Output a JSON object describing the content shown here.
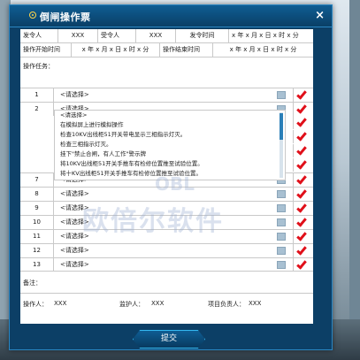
{
  "dialog": {
    "title": "倒闸操作票",
    "close": "×"
  },
  "header": {
    "issuer_label": "发令人",
    "issuer_value": "XXX",
    "receiver_label": "受令人",
    "receiver_value": "XXX",
    "issue_time_label": "发令时间",
    "issue_time_value": "x 年 x 月 x 日 x 时 x 分",
    "start_time_label": "操作开始时间",
    "start_time_value": "x 年 x 月 x 日 x 时 x 分",
    "end_time_label": "操作结束时间",
    "end_time_value": "x 年 x 月 x 日 x 时 x 分"
  },
  "task_label": "操作任务：",
  "tasks": [
    {
      "num": "1",
      "value": "<请选择>"
    },
    {
      "num": "2",
      "value": "<请选择>"
    },
    {
      "num": "7",
      "value": "<请选择>"
    },
    {
      "num": "8",
      "value": "<请选择>"
    },
    {
      "num": "9",
      "value": "<请选择>"
    },
    {
      "num": "10",
      "value": "<请选择>"
    },
    {
      "num": "11",
      "value": "<请选择>"
    },
    {
      "num": "12",
      "value": "<请选择>"
    },
    {
      "num": "13",
      "value": "<请选择>"
    }
  ],
  "dropdown_options": [
    "<请选择>",
    "在模拟屏上进行模拟操作",
    "检查10KV出线柜51开关带电显示三相指示灯灭。",
    "检查三相指示灯灭。",
    "挂下\"禁止合闸，有人工作\"警示牌",
    "将10KV出线柜51开关手推车有检修位置推至试验位置。",
    "将十KV出线柜51开关手推车有检修位置推至试验位置。"
  ],
  "remark_label": "备注：",
  "footer": {
    "operator_label": "操作人：",
    "operator_value": "XXX",
    "supervisor_label": "监护人：",
    "supervisor_value": "XXX",
    "manager_label": "项目负责人：",
    "manager_value": "XXX"
  },
  "submit_label": "提交",
  "watermark": {
    "logo": "OBL",
    "text": "欧倍尔软件"
  },
  "colors": {
    "dialog_bg": "#0c3f66",
    "accent": "#2a86c2",
    "check": "#e0101a"
  }
}
